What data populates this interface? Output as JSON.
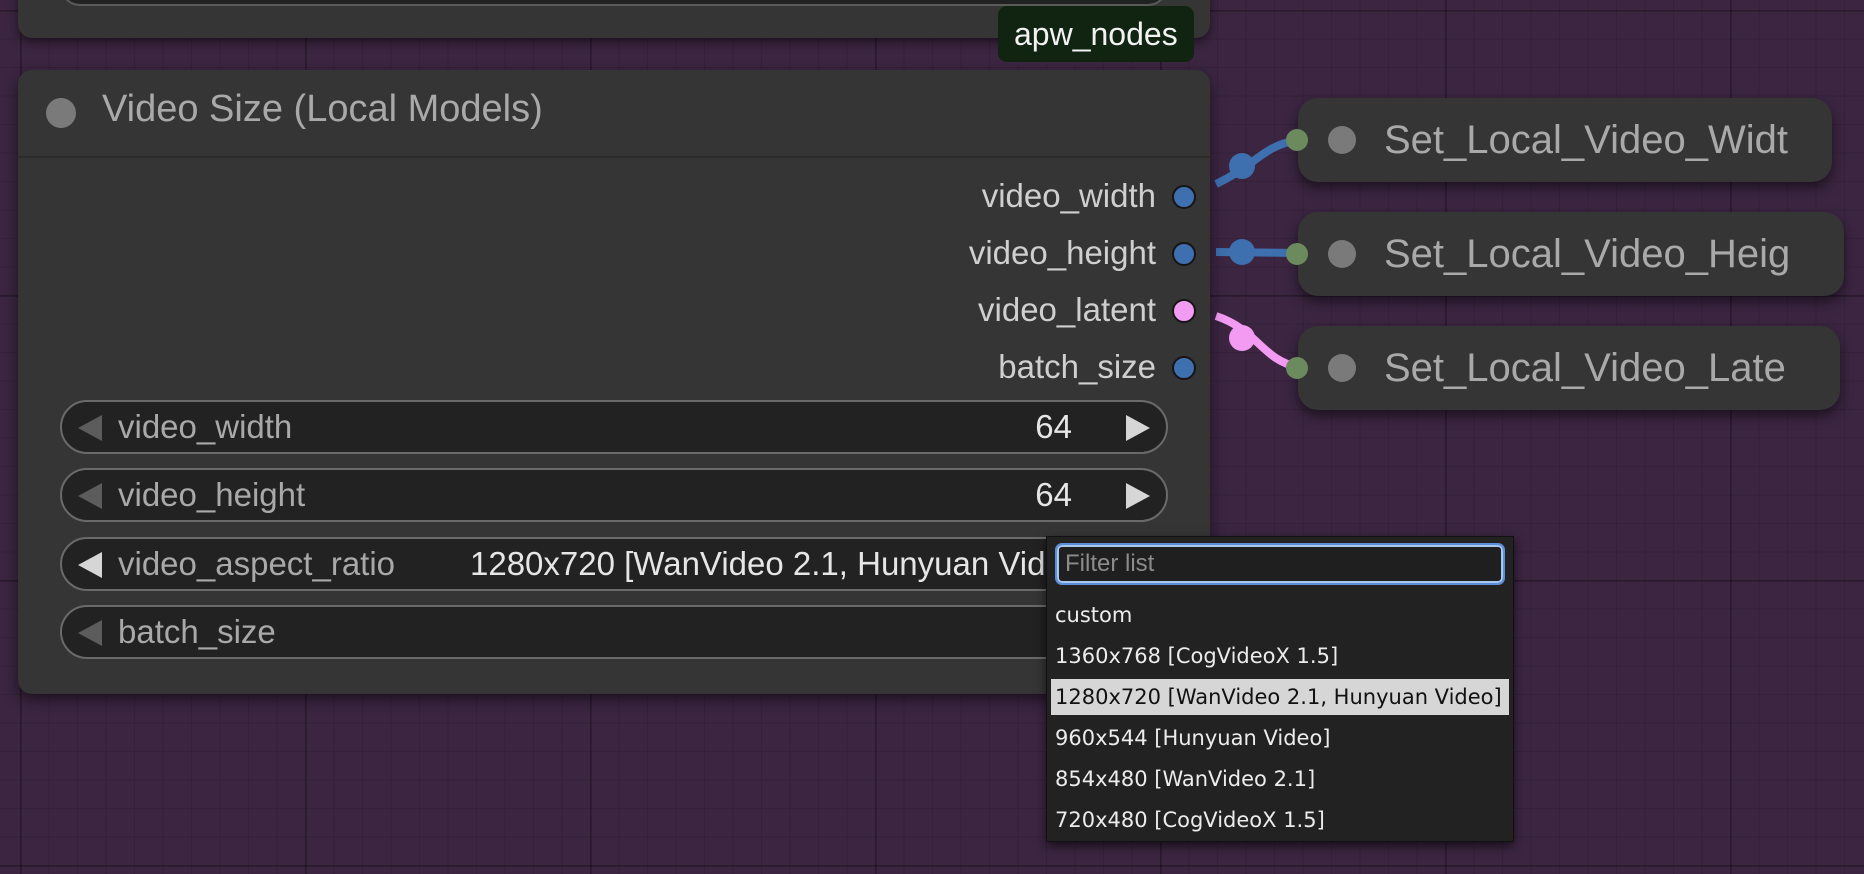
{
  "badge": "apw_nodes",
  "node": {
    "title": "Video Size (Local Models)",
    "outputs": [
      {
        "label": "video_width",
        "color": "#3e6fae"
      },
      {
        "label": "video_height",
        "color": "#3e6fae"
      },
      {
        "label": "video_latent",
        "color": "#f39bf3"
      },
      {
        "label": "batch_size",
        "color": "#3e6fae"
      }
    ],
    "widgets": {
      "video_width": {
        "label": "video_width",
        "value": "64"
      },
      "video_height": {
        "label": "video_height",
        "value": "64"
      },
      "video_aspect_ratio": {
        "label": "video_aspect_ratio",
        "value": "1280x720 [WanVideo 2.1, Hunyuan Video]"
      },
      "batch_size": {
        "label": "batch_size"
      }
    }
  },
  "set_nodes": [
    {
      "title": "Set_Local_Video_Widt"
    },
    {
      "title": "Set_Local_Video_Heig"
    },
    {
      "title": "Set_Local_Video_Late"
    }
  ],
  "dropdown": {
    "filter_placeholder": "Filter list",
    "filter_value": "",
    "items": [
      "custom",
      "1360x768 [CogVideoX 1.5]",
      "1280x720 [WanVideo 2.1, Hunyuan Video]",
      "960x544 [Hunyuan Video]",
      "854x480 [WanVideo 2.1]",
      "720x480 [CogVideoX 1.5]"
    ],
    "selected": "1280x720 [WanVideo 2.1, Hunyuan Video]"
  },
  "colors": {
    "int_link": "#3e6fae",
    "latent_link": "#f39bf3",
    "canvas": "#3b2541",
    "set_input": "#6b8a5e"
  },
  "icons": [
    "node-status-dot-icon",
    "arrow-left-icon",
    "arrow-right-icon"
  ]
}
